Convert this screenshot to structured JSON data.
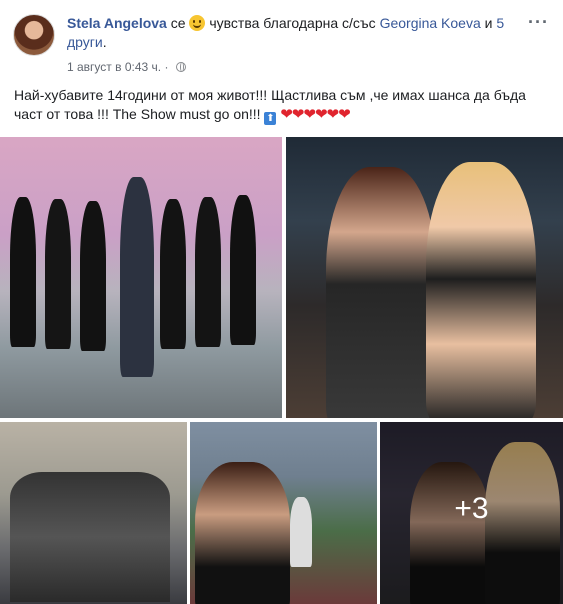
{
  "author": {
    "name": "Stela Angelova",
    "feeling_prefix": " се ",
    "feeling_text": " чувства благодарна с/със ",
    "tagged": "Georgina Koeva",
    "and_text": " и ",
    "others": "5 други",
    "period": "."
  },
  "meta": {
    "date": "1 август в 0:43 ч.",
    "separator": " · "
  },
  "post": {
    "text": "Най-хубавите 14години от моя живот!!! Щастлива съм ,че имах шанса да бъда част от това !!! The Show must go on!!!",
    "hearts": "❤❤❤❤❤❤"
  },
  "menu": {
    "more": "···"
  },
  "photos": {
    "more_count": "+3"
  },
  "colors": {
    "link": "#385898",
    "text": "#1c1e21",
    "meta": "#616770",
    "heart": "#e0242e"
  }
}
